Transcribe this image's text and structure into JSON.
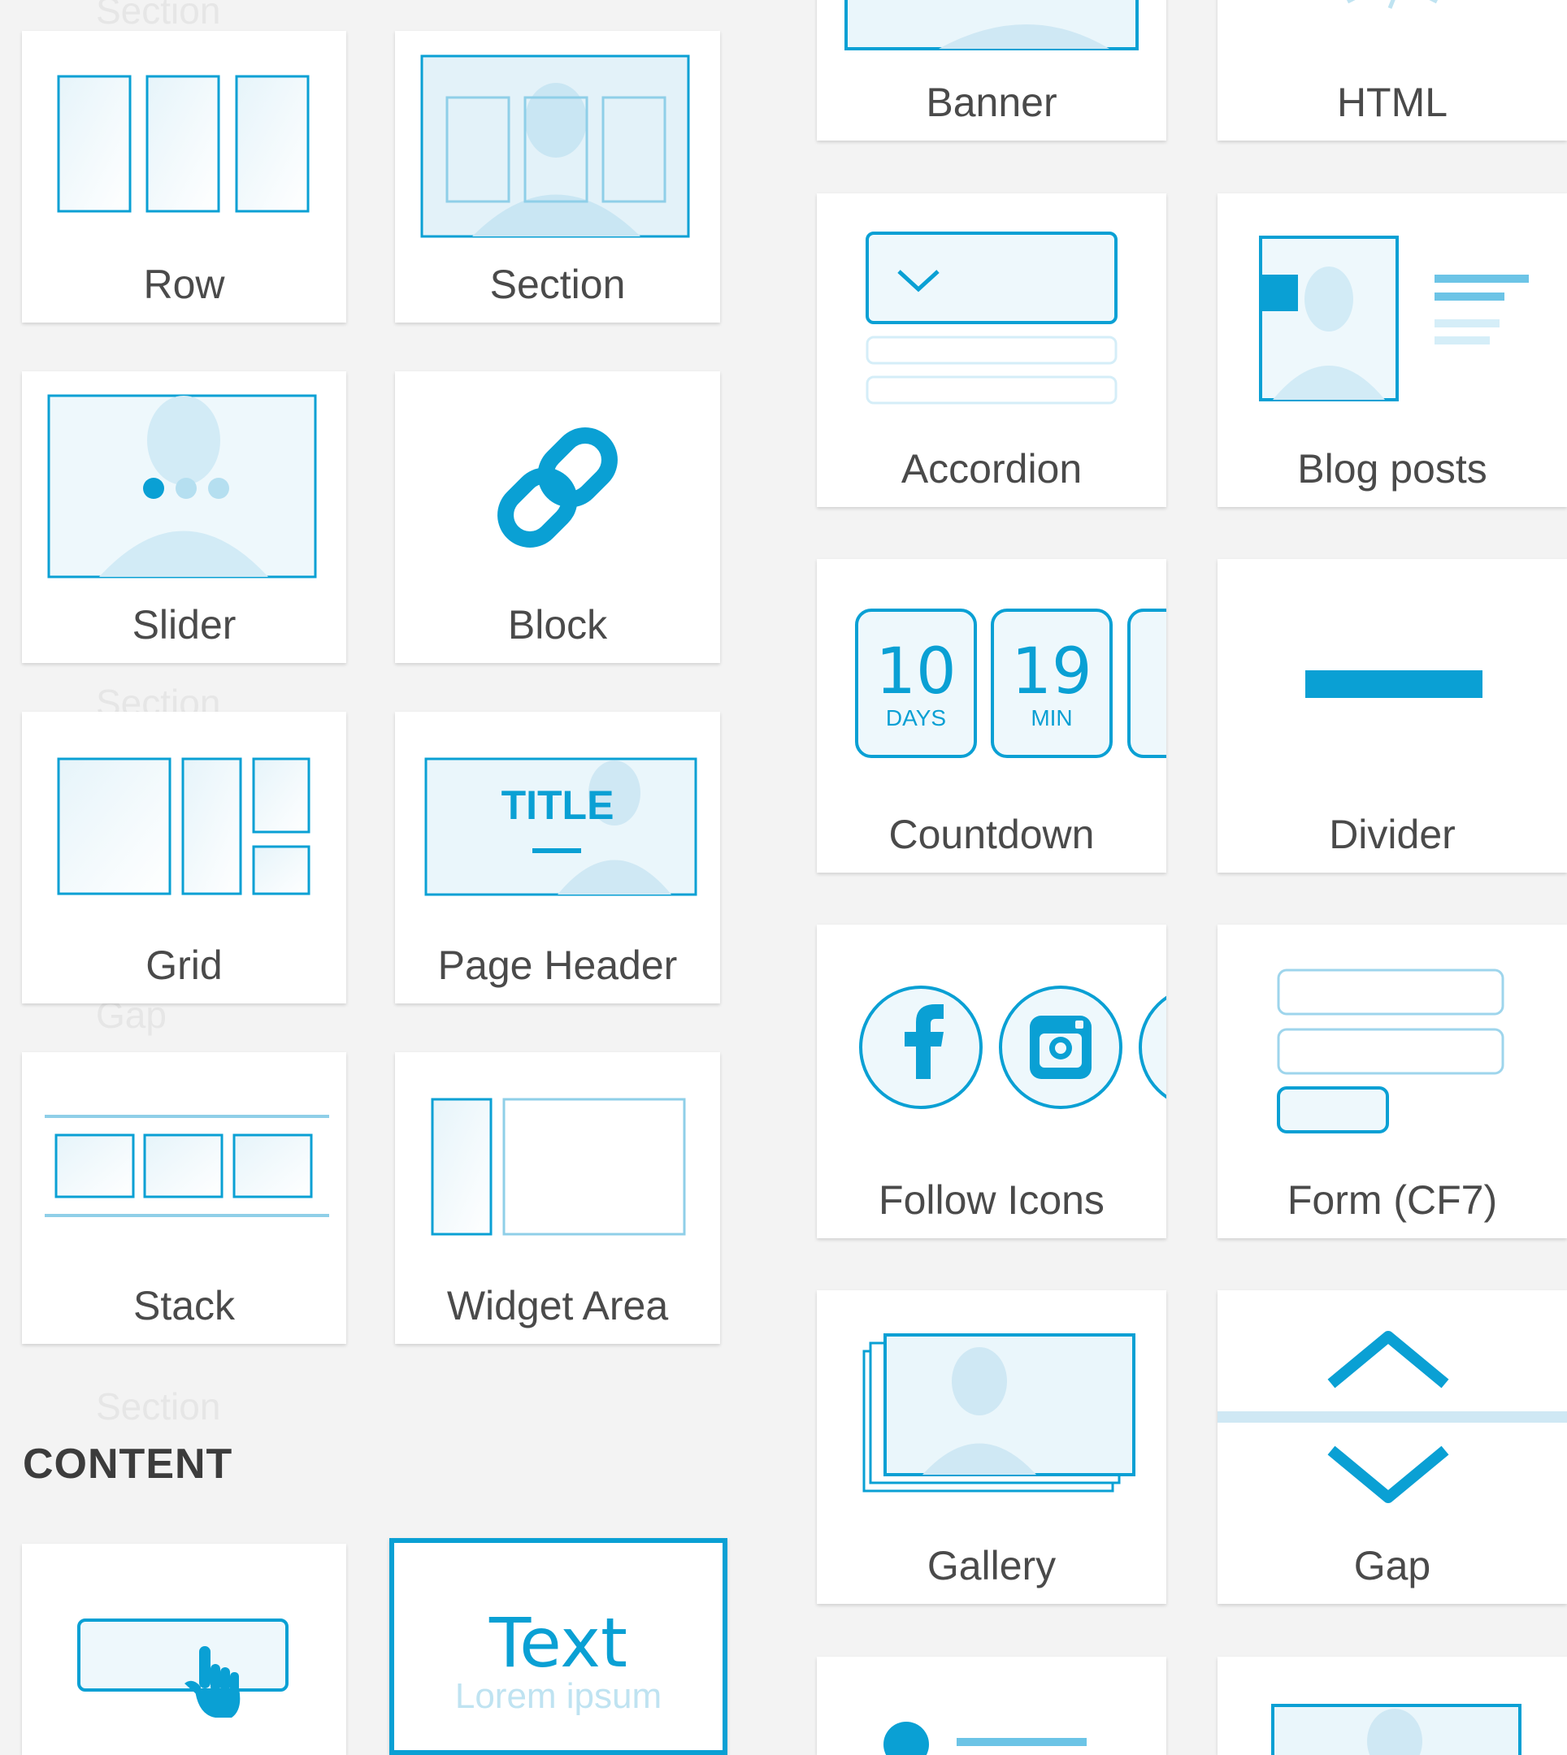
{
  "layout_group": {
    "items": [
      {
        "name": "row-card",
        "label": "Row"
      },
      {
        "name": "section-card",
        "label": "Section"
      },
      {
        "name": "slider-card",
        "label": "Slider"
      },
      {
        "name": "block-card",
        "label": "Block"
      },
      {
        "name": "grid-card",
        "label": "Grid"
      },
      {
        "name": "page-header-card",
        "label": "Page Header"
      },
      {
        "name": "stack-card",
        "label": "Stack"
      },
      {
        "name": "widget-area-card",
        "label": "Widget Area"
      }
    ]
  },
  "content_heading": "CONTENT",
  "content_group": {
    "items": [
      {
        "name": "button-card",
        "label": ""
      },
      {
        "name": "text-card",
        "label": "",
        "text": "Text",
        "sub": "Lorem ipsum"
      }
    ]
  },
  "right_group": {
    "items": [
      {
        "name": "banner-card",
        "label": "Banner"
      },
      {
        "name": "html-card",
        "label": "HTML"
      },
      {
        "name": "accordion-card",
        "label": "Accordion"
      },
      {
        "name": "blog-posts-card",
        "label": "Blog posts"
      },
      {
        "name": "countdown-card",
        "label": "Countdown",
        "days": "10",
        "days_unit": "DAYS",
        "min": "19",
        "min_unit": "MIN"
      },
      {
        "name": "divider-card",
        "label": "Divider"
      },
      {
        "name": "follow-icons-card",
        "label": "Follow Icons"
      },
      {
        "name": "form-cf7-card",
        "label": "Form (CF7)"
      },
      {
        "name": "gallery-card",
        "label": "Gallery"
      },
      {
        "name": "gap-card",
        "label": "Gap"
      }
    ]
  },
  "ghost_labels": [
    "Section",
    "Section",
    "Gap",
    "Section"
  ],
  "colors": {
    "accent": "#0aa0d4",
    "accent_light": "#cfeaf5",
    "label": "#4a4a4a",
    "bg": "#f3f3f3"
  }
}
